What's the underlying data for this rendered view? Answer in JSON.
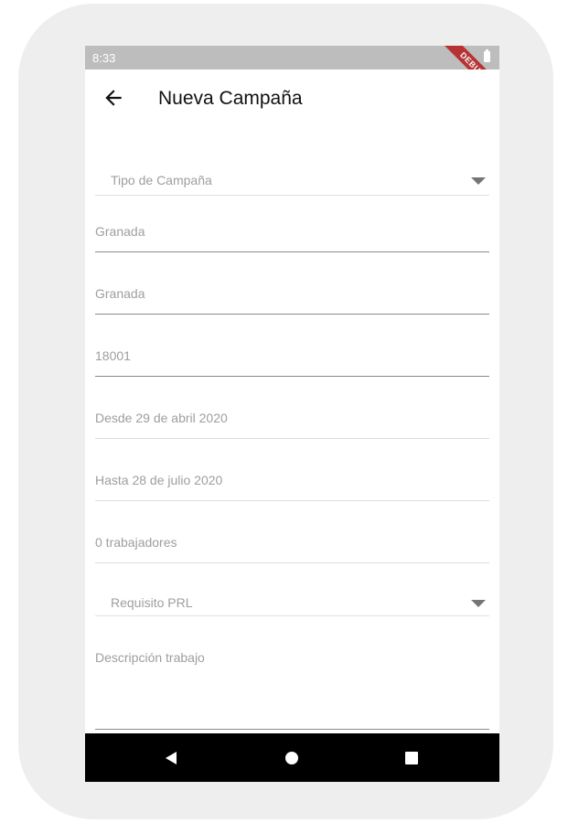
{
  "status_bar": {
    "time": "8:33",
    "debug_badge": "DEBUG"
  },
  "app_bar": {
    "title": "Nueva Campaña",
    "back_icon": "arrow-left-icon"
  },
  "form": {
    "campaign_type": {
      "placeholder": "Tipo de Campaña"
    },
    "province": {
      "value": "Granada"
    },
    "city": {
      "value": "Granada"
    },
    "postal_code": {
      "value": "18001"
    },
    "start_date": {
      "value": "Desde 29 de abril 2020"
    },
    "end_date": {
      "value": "Hasta 28 de julio 2020"
    },
    "workers": {
      "value": "0 trabajadores"
    },
    "prl_requirement": {
      "placeholder": "Requisito PRL"
    },
    "job_description": {
      "placeholder": "Descripción trabajo"
    }
  },
  "nav_bar": {
    "back_icon": "triangle-back-icon",
    "home_icon": "circle-home-icon",
    "recents_icon": "square-recents-icon"
  },
  "colors": {
    "status_bar": "#bdbdbd",
    "debug_ribbon": "#b71c1c",
    "hint_text": "#9e9e9e",
    "nav_bar": "#000000"
  }
}
